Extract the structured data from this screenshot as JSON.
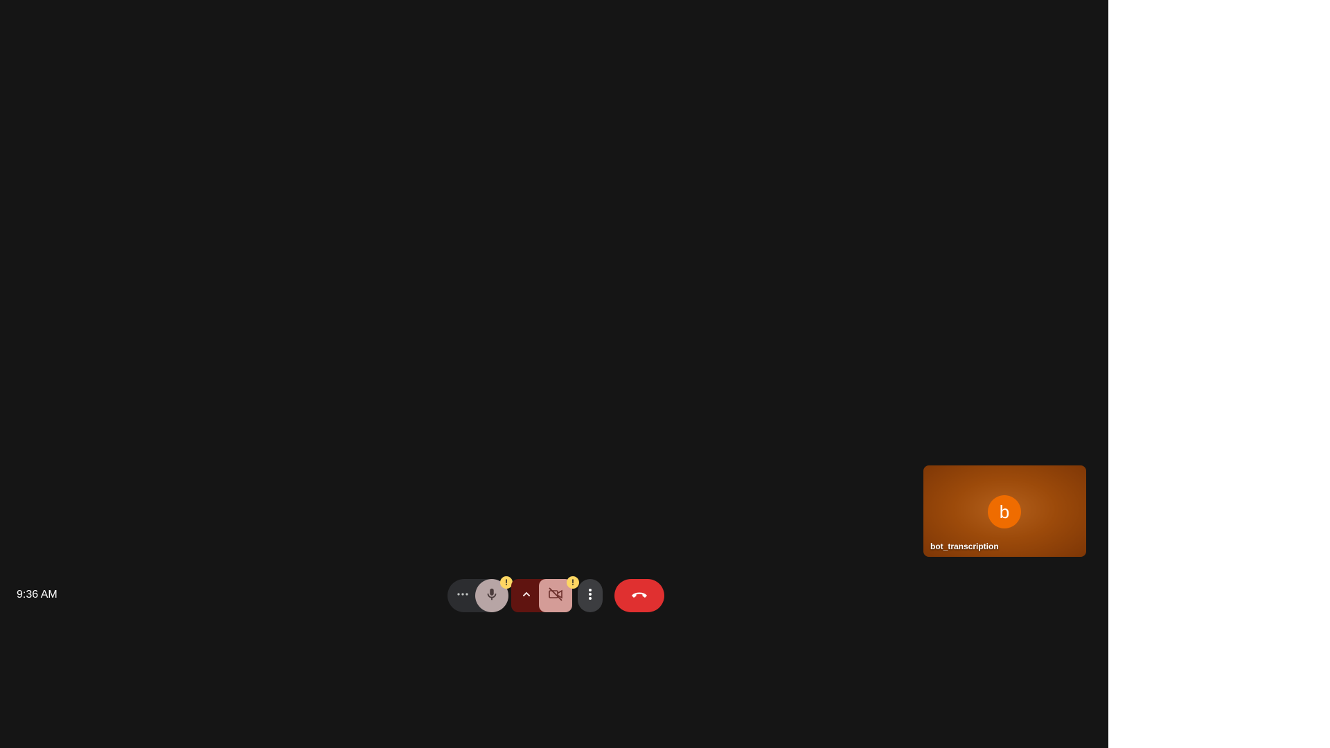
{
  "meeting": {
    "self_tile": {
      "avatar_initial": "b",
      "name": "bot_transcription"
    }
  },
  "bottom_bar": {
    "time": "9:36 AM",
    "controls": {
      "more_audio_icon": "more-horiz-icon",
      "mic_icon": "mic-icon",
      "mic_warning": "!",
      "camera_options_icon": "chevron-up-icon",
      "camera_icon": "videocam-off-icon",
      "camera_warning": "!",
      "more_options_icon": "more-vert-icon",
      "end_call_icon": "call-end-icon"
    }
  },
  "colors": {
    "stage_bg": "#151515",
    "mic_button": "#b7a5a5",
    "camera_off_bg": "#601410",
    "camera_button": "#d49c97",
    "end_call": "#e03030",
    "warning_badge": "#fdd663",
    "avatar": "#ef6c00"
  }
}
